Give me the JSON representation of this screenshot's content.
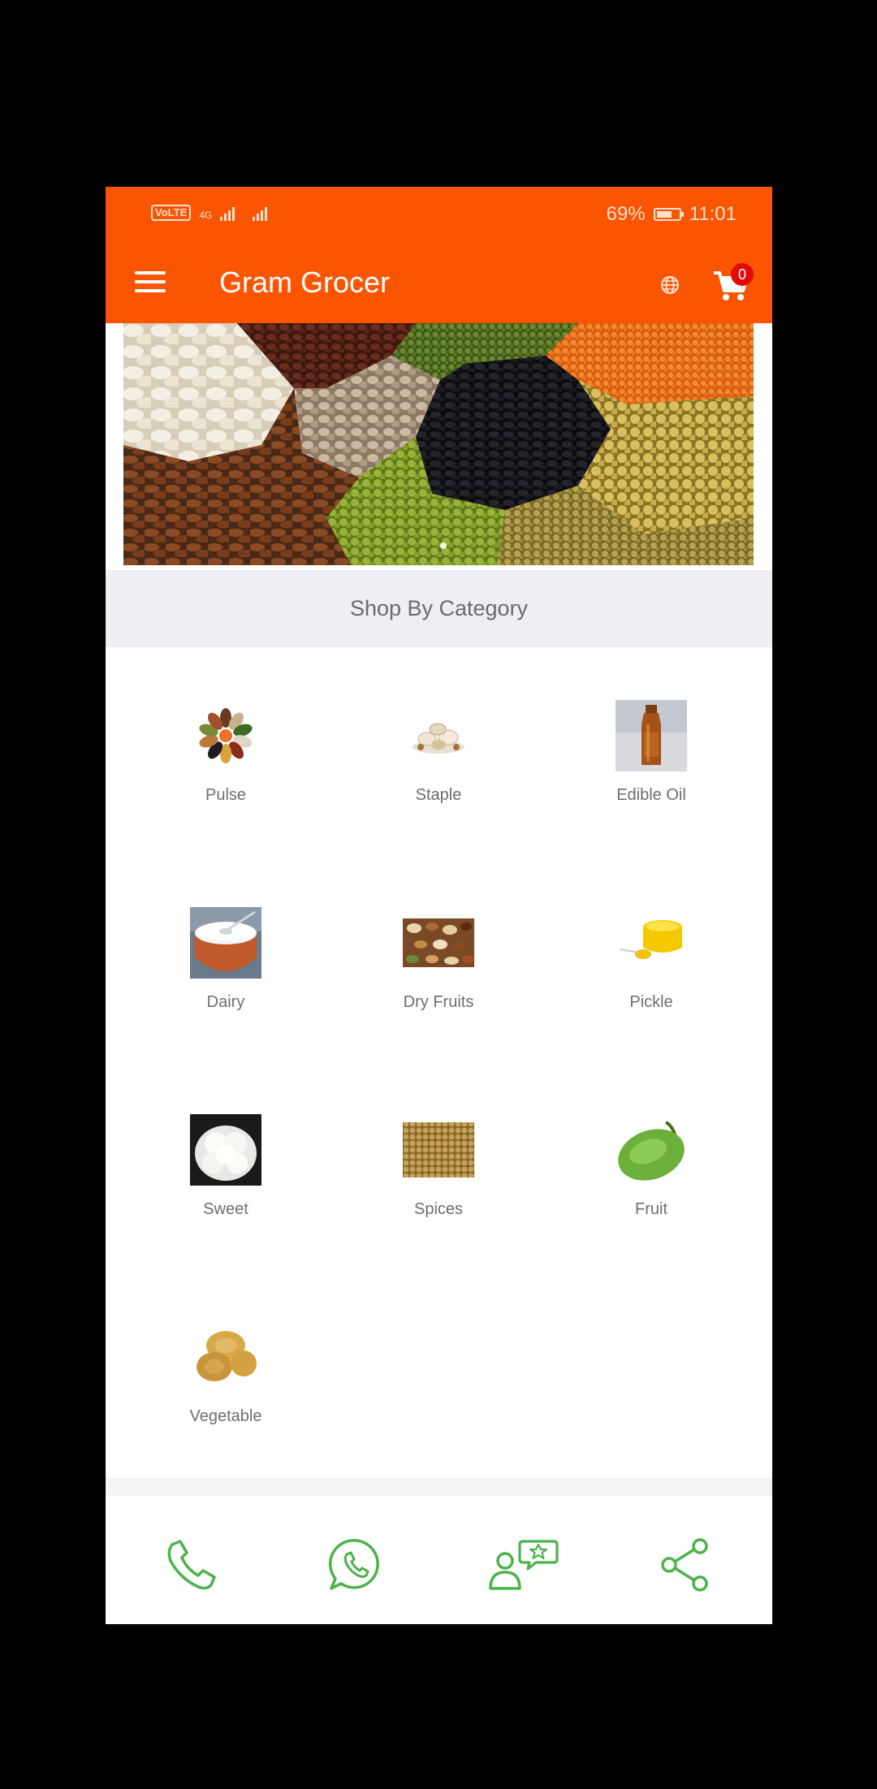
{
  "status_bar": {
    "network_badge": "VoLTE",
    "network_type": "4G",
    "battery": "69%",
    "time": "11:01"
  },
  "app_bar": {
    "title": "Gram Grocer",
    "cart_count": "0",
    "icons": [
      "menu-icon",
      "globe-icon",
      "cart-icon"
    ],
    "background": "#f95503"
  },
  "banner": {
    "slides_indicator_active": 0
  },
  "category_section": {
    "title": "Shop By Category",
    "items": [
      {
        "label": "Pulse"
      },
      {
        "label": "Staple"
      },
      {
        "label": "Edible Oil"
      },
      {
        "label": "Dairy"
      },
      {
        "label": "Dry Fruits"
      },
      {
        "label": "Pickle"
      },
      {
        "label": "Sweet"
      },
      {
        "label": "Spices"
      },
      {
        "label": "Fruit"
      },
      {
        "label": "Vegetable"
      }
    ]
  },
  "bottom_bar": {
    "icons": [
      "phone-icon",
      "whatsapp-icon",
      "feedback-icon",
      "share-icon"
    ],
    "accent": "#4cb34a"
  }
}
